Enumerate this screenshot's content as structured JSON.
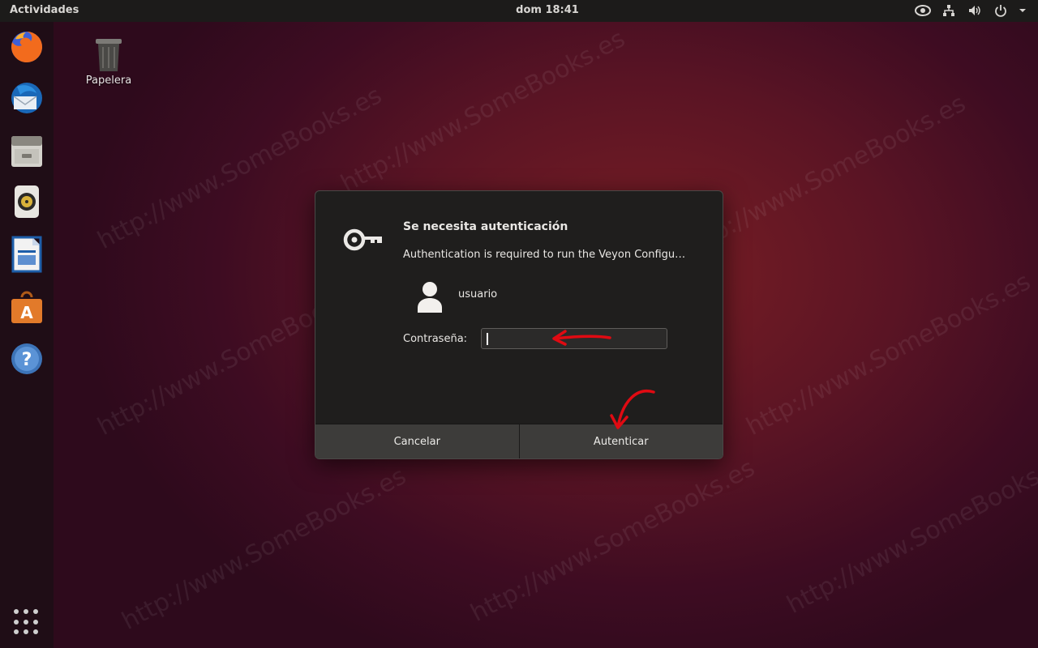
{
  "topbar": {
    "activities_label": "Actividades",
    "clock": "dom 18:41",
    "tray_icons": [
      "eye-icon",
      "network-icon",
      "volume-icon",
      "power-icon",
      "chevron-down-icon"
    ]
  },
  "dock": {
    "items": [
      "firefox-icon",
      "thunderbird-icon",
      "files-icon",
      "rhythmbox-icon",
      "writer-icon",
      "software-icon",
      "help-icon"
    ],
    "apps_grid_icon": "apps-grid-icon"
  },
  "desktop": {
    "trash_label": "Papelera"
  },
  "watermark": "http://www.SomeBooks.es",
  "dialog": {
    "title": "Se necesita autenticación",
    "message": "Authentication is required to run the Veyon Configu…",
    "user_name": "usuario",
    "password_label": "Contraseña:",
    "password_value": "",
    "cancel_label": "Cancelar",
    "authenticate_label": "Autenticar"
  },
  "colors": {
    "annotation_arrow": "#e00a12",
    "dialog_bg": "#1f1e1d",
    "button_bg": "#3d3c3a"
  }
}
